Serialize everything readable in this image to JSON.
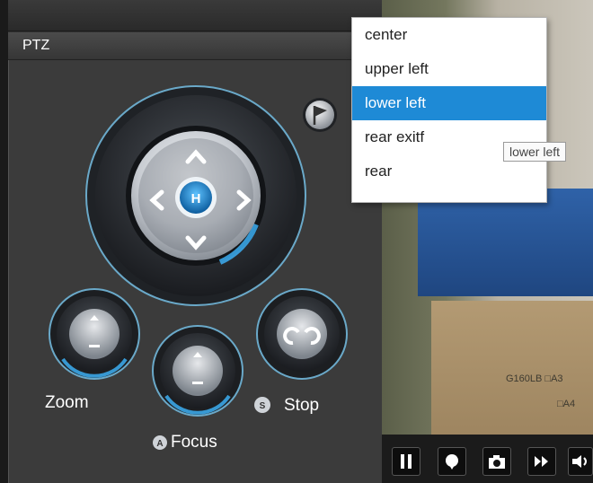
{
  "panel": {
    "title": "PTZ"
  },
  "labels": {
    "zoom": "Zoom",
    "focus": "Focus",
    "stop": "Stop"
  },
  "joystick": {
    "home": "H"
  },
  "preset_menu": {
    "items": [
      "center",
      "upper left",
      "lower left",
      "rear exitf",
      "rear"
    ],
    "selected": "lower left",
    "tooltip": "lower left"
  },
  "video": {
    "box_text_1": "G160LB □A3",
    "box_text_2": "□A4"
  },
  "colors": {
    "accent": "#1e8ad6",
    "glow": "#3fb6ff"
  },
  "icons": [
    "flag-icon",
    "pause-icon",
    "speech-bubble-icon",
    "camera-icon",
    "fast-forward-icon",
    "speaker-icon"
  ]
}
